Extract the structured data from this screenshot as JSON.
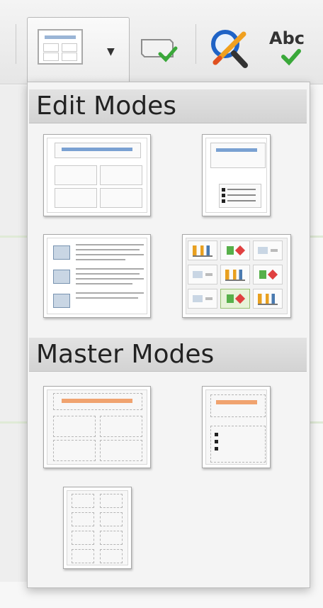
{
  "popup": {
    "edit_section": {
      "title": "Edit Modes"
    },
    "master_section": {
      "title": "Master Modes"
    }
  },
  "toolbar": {
    "icons": [
      "layout-icon",
      "chevron-down-icon",
      "slide-check-icon",
      "zoom-pen-icon",
      "spellcheck-icon"
    ],
    "spellcheck_text": "Abc"
  },
  "colors": {
    "header_bg": "#d6d6d6",
    "title_bar_blue": "#7aa1d2",
    "title_bar_orange": "#f0a36f",
    "check_green": "#3aa83a"
  }
}
